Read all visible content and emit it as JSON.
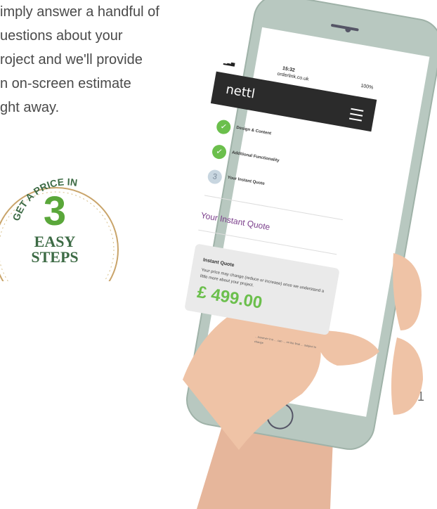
{
  "intro": {
    "lines": [
      "imply answer a handful of",
      "uestions about your",
      "roject and we'll provide",
      "n on-screen estimate",
      "ght away."
    ]
  },
  "badge": {
    "top_text": "GET A PRICE IN",
    "number": "3",
    "line1": "EASY",
    "line2": "STEPS",
    "colors": {
      "ring": "#c9a46a",
      "text": "#3d6b45",
      "number": "#5aa73a"
    }
  },
  "page_number": "21",
  "phone": {
    "status": {
      "time": "15:32",
      "url": "orderlink.co.uk",
      "battery": "100%"
    },
    "brand": "nettl",
    "steps": [
      {
        "label": "Design & Content",
        "state": "done"
      },
      {
        "label": "Additional Functionality",
        "state": "done"
      },
      {
        "label": "Your Instant Quote",
        "state": "pending",
        "number": "3"
      }
    ],
    "quote_title": "Your Instant Quote",
    "card": {
      "title": "Instant Quote",
      "text": "Your price may change (reduce or increase) once we understand a little more about your project.",
      "price": "£ 499.00"
    },
    "fine_print": "…however it is … can … on the final … subject to change",
    "colors": {
      "accent": "#6bbf4c",
      "title": "#7b3e8b",
      "header": "#2b2b2b"
    }
  }
}
